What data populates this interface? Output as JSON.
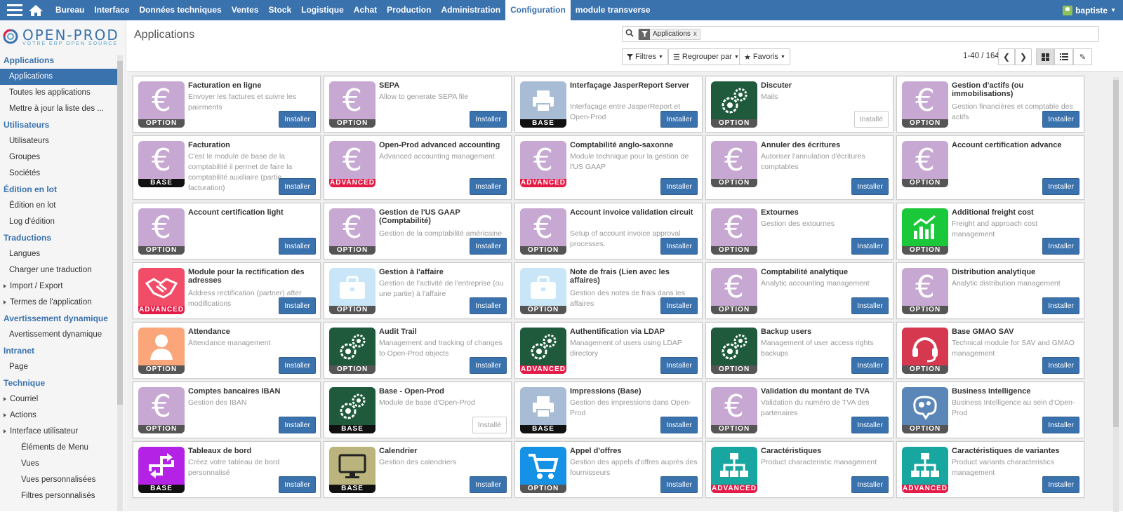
{
  "nav": {
    "items": [
      "Bureau",
      "Interface",
      "Données techniques",
      "Ventes",
      "Stock",
      "Logistique",
      "Achat",
      "Production",
      "Administration",
      "Configuration",
      "module transverse"
    ],
    "active_index": 9,
    "user": "baptiste"
  },
  "logo": {
    "name": "OPEN-PROD",
    "tagline": "VOTRE ERP OPEN SOURCE"
  },
  "sidebar": {
    "sections": [
      {
        "title": "Applications",
        "items": [
          {
            "label": "Applications",
            "active": true
          },
          {
            "label": "Toutes les applications"
          },
          {
            "label": "Mettre à jour la liste des ..."
          }
        ]
      },
      {
        "title": "Utilisateurs",
        "items": [
          {
            "label": "Utilisateurs"
          },
          {
            "label": "Groupes"
          },
          {
            "label": "Sociétés"
          }
        ]
      },
      {
        "title": "Édition en lot",
        "items": [
          {
            "label": "Édition en lot"
          },
          {
            "label": "Log d'édition"
          }
        ]
      },
      {
        "title": "Traductions",
        "items": [
          {
            "label": "Langues"
          },
          {
            "label": "Charger une traduction"
          },
          {
            "label": "Import / Export",
            "caret": true
          },
          {
            "label": "Termes de l'application",
            "caret": true
          }
        ]
      },
      {
        "title": "Avertissement dynamique",
        "items": [
          {
            "label": "Avertissement dynamique"
          }
        ]
      },
      {
        "title": "Intranet",
        "items": [
          {
            "label": "Page"
          }
        ]
      },
      {
        "title": "Technique",
        "items": [
          {
            "label": "Courriel",
            "caret": true
          },
          {
            "label": "Actions",
            "caret": true
          },
          {
            "label": "Interface utilisateur",
            "caret": true
          },
          {
            "label": "Éléments de Menu",
            "sub": true
          },
          {
            "label": "Vues",
            "sub": true
          },
          {
            "label": "Vues personnalisées",
            "sub": true
          },
          {
            "label": "Filtres personnalisés",
            "sub": true
          }
        ]
      }
    ]
  },
  "header": {
    "title": "Applications",
    "search_facet": "Applications",
    "search_facet_remove": "x",
    "filters_label": "Filtres",
    "group_label": "Regrouper par",
    "favorites_label": "Favoris",
    "pager": "1-40 / 164"
  },
  "colors": {
    "accent": "#3a72ae",
    "euro_bg": "#c7a8d3",
    "green_dark": "#1e5a3b"
  },
  "modules": [
    {
      "title": "Facturation en ligne",
      "desc": "Envoyer les factures et suivre les paiements",
      "icon": "euro-icon",
      "bg": "#c7a8d3",
      "ribbon": "OPTION",
      "button": "Installer"
    },
    {
      "title": "SEPA",
      "desc": "Allow to generate SEPA file",
      "icon": "euro-icon",
      "bg": "#c7a8d3",
      "ribbon": "OPTION",
      "button": "Installer"
    },
    {
      "title": "Interfaçage JasperReport Server",
      "desc": "Interfaçage entre JasperReport et Open-Prod",
      "icon": "printer-icon",
      "bg": "#a8bcd6",
      "ribbon": "BASE",
      "button": "Installer"
    },
    {
      "title": "Discuter",
      "desc": "Mails",
      "icon": "gears-icon",
      "bg": "#1e5a3b",
      "ribbon": "OPTION",
      "button": "Installé",
      "installed": true
    },
    {
      "title": "Gestion d'actifs (ou immobilisations)",
      "desc": "Gestion financières et comptable des actifs",
      "icon": "euro-icon",
      "bg": "#c7a8d3",
      "ribbon": "OPTION",
      "button": "Installer"
    },
    {
      "title": "Facturation",
      "desc": "C'est le module de base de la comptabilité il permet de faire la comptabilité auxiliaire (partie facturation)",
      "icon": "euro-icon",
      "bg": "#c7a8d3",
      "ribbon": "BASE",
      "button": "Installer"
    },
    {
      "title": "Open-Prod advanced accounting",
      "desc": "Advanced accounting management",
      "icon": "euro-icon",
      "bg": "#c7a8d3",
      "ribbon": "ADVANCED",
      "button": "Installer"
    },
    {
      "title": "Comptabilité anglo-saxonne",
      "desc": "Module technique pour la gestion de l'US GAAP",
      "icon": "euro-icon",
      "bg": "#c7a8d3",
      "ribbon": "ADVANCED",
      "button": "Installer"
    },
    {
      "title": "Annuler des écritures",
      "desc": "Autoriser l'annulation d'écritures comptables",
      "icon": "euro-icon",
      "bg": "#c7a8d3",
      "ribbon": "OPTION",
      "button": "Installer"
    },
    {
      "title": "Account certification advance",
      "desc": "",
      "icon": "euro-icon",
      "bg": "#c7a8d3",
      "ribbon": "OPTION",
      "button": "Installer"
    },
    {
      "title": "Account certification light",
      "desc": "",
      "icon": "euro-icon",
      "bg": "#c7a8d3",
      "ribbon": "OPTION",
      "button": "Installer"
    },
    {
      "title": "Gestion de l'US GAAP (Comptabilité)",
      "desc": "Gestion de la comptabilité américaine",
      "icon": "euro-icon",
      "bg": "#c7a8d3",
      "ribbon": "OPTION",
      "button": "Installer"
    },
    {
      "title": "Account invoice validation circuit",
      "desc": "Setup of account invoice approval processes.",
      "icon": "euro-icon",
      "bg": "#c7a8d3",
      "ribbon": "OPTION",
      "button": "Installer"
    },
    {
      "title": "Extournes",
      "desc": "Gestion des extournes",
      "icon": "euro-icon",
      "bg": "#c7a8d3",
      "ribbon": "OPTION",
      "button": "Installer"
    },
    {
      "title": "Additional freight cost",
      "desc": "Freight and approach cost management",
      "icon": "chart-icon",
      "bg": "#1bc83a",
      "ribbon": "OPTION",
      "button": "Installer"
    },
    {
      "title": "Module pour la rectification des adresses",
      "desc": "Address rectification (partner) after modifications",
      "icon": "handshake-icon",
      "bg": "#f24d68",
      "ribbon": "ADVANCED",
      "button": "Installer"
    },
    {
      "title": "Gestion à l'affaire",
      "desc": "Gestion de l'activité de l'entreprise (ou une partie) à l'affaire",
      "icon": "briefcase-icon",
      "bg": "#c9e6f8",
      "ribbon": "OPTION",
      "button": "Installer"
    },
    {
      "title": "Note de frais (Lien avec les affaires)",
      "desc": "Gestion des notes de frais dans les affaires",
      "icon": "briefcase-icon",
      "bg": "#c9e6f8",
      "ribbon": "OPTION",
      "button": "Installer"
    },
    {
      "title": "Comptabilité analytique",
      "desc": "Analytic accounting management",
      "icon": "euro-icon",
      "bg": "#c7a8d3",
      "ribbon": "OPTION",
      "button": "Installer"
    },
    {
      "title": "Distribution analytique",
      "desc": "Analytic distribution management",
      "icon": "euro-icon",
      "bg": "#c7a8d3",
      "ribbon": "OPTION",
      "button": "Installer"
    },
    {
      "title": "Attendance",
      "desc": "Attendance management",
      "icon": "person-icon",
      "bg": "#fba57a",
      "ribbon": "OPTION",
      "button": "Installer"
    },
    {
      "title": "Audit Trail",
      "desc": "Management and tracking of changes to Open-Prod objects",
      "icon": "gears-icon",
      "bg": "#1e5a3b",
      "ribbon": "OPTION",
      "button": "Installer"
    },
    {
      "title": "Authentification via LDAP",
      "desc": "Management of users using LDAP directory",
      "icon": "gears-icon",
      "bg": "#1e5a3b",
      "ribbon": "ADVANCED",
      "button": "Installer"
    },
    {
      "title": "Backup users",
      "desc": "Management of user access rights backups",
      "icon": "gears-icon",
      "bg": "#1e5a3b",
      "ribbon": "OPTION",
      "button": "Installer"
    },
    {
      "title": "Base GMAO SAV",
      "desc": "Technical module for SAV and GMAO management",
      "icon": "headset-icon",
      "bg": "#d6384f",
      "ribbon": "OPTION",
      "button": "Installer"
    },
    {
      "title": "Comptes bancaires IBAN",
      "desc": "Gestion des IBAN",
      "icon": "euro-icon",
      "bg": "#c7a8d3",
      "ribbon": "OPTION",
      "button": "Installer"
    },
    {
      "title": "Base - Open-Prod",
      "desc": "Module de base d'Open-Prod",
      "icon": "gears-icon",
      "bg": "#1e5a3b",
      "ribbon": "BASE",
      "button": "Installé",
      "installed": true
    },
    {
      "title": "Impressions (Base)",
      "desc": "Gestion des impressions dans Open-Prod",
      "icon": "printer-icon",
      "bg": "#a8bcd6",
      "ribbon": "BASE",
      "button": "Installer"
    },
    {
      "title": "Validation du montant de TVA",
      "desc": "Validation du numéro de TVA des partenaires",
      "icon": "euro-icon",
      "bg": "#c7a8d3",
      "ribbon": "OPTION",
      "button": "Installer"
    },
    {
      "title": "Business Intelligence",
      "desc": "Business Intelligence au sein d'Open-Prod",
      "icon": "brain-icon",
      "bg": "#5b86b8",
      "ribbon": "OPTION",
      "button": "Installer"
    },
    {
      "title": "Tableaux de bord",
      "desc": "Créez votre tableau de bord personnalisé",
      "icon": "arrows-icon",
      "bg": "#b422e6",
      "ribbon": "BASE",
      "button": "Installer"
    },
    {
      "title": "Calendrier",
      "desc": "Gestion des calendriers",
      "icon": "monitor-icon",
      "bg": "#bbb47c",
      "ribbon": "BASE",
      "button": "Installer"
    },
    {
      "title": "Appel d'offres",
      "desc": "Gestion des appels d'offres auprès des fournisseurs",
      "icon": "cart-icon",
      "bg": "#1591e6",
      "ribbon": "OPTION",
      "button": "Installer"
    },
    {
      "title": "Caractéristiques",
      "desc": "Product characteristic management",
      "icon": "org-chart-icon",
      "bg": "#17a7a0",
      "ribbon": "ADVANCED",
      "button": "Installer"
    },
    {
      "title": "Caractéristiques de variantes",
      "desc": "Product variants characteristics management",
      "icon": "org-chart-icon",
      "bg": "#17a7a0",
      "ribbon": "ADVANCED",
      "button": "Installer"
    }
  ]
}
